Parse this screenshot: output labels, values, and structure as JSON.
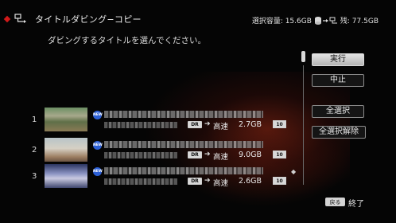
{
  "header": {
    "title": "タイトルダビング−コピー",
    "capacity_label": "選択容量: 15.6GB",
    "remaining_label": "残: 77.5GB"
  },
  "instruction": "ダビングするタイトルを選んでください。",
  "actions": {
    "execute": "実行",
    "cancel": "中止",
    "select_all": "全選択",
    "deselect_all": "全選択解除"
  },
  "titles": [
    {
      "number": "1",
      "badge": "NEW",
      "mode": "DR",
      "speed": "高速",
      "size": "2.7GB",
      "forward": "10"
    },
    {
      "number": "2",
      "badge": "NEW",
      "mode": "DR",
      "speed": "高速",
      "size": "9.0GB",
      "forward": "10"
    },
    {
      "number": "3",
      "badge": "NEW",
      "mode": "DR",
      "speed": "高速",
      "size": "2.6GB",
      "forward": "10"
    }
  ],
  "footer": {
    "back_key": "戻る",
    "exit_label": "終了"
  },
  "colors": {
    "background": "#050505",
    "accent_red": "#d21a1a",
    "new_badge": "#2b5fd6"
  }
}
